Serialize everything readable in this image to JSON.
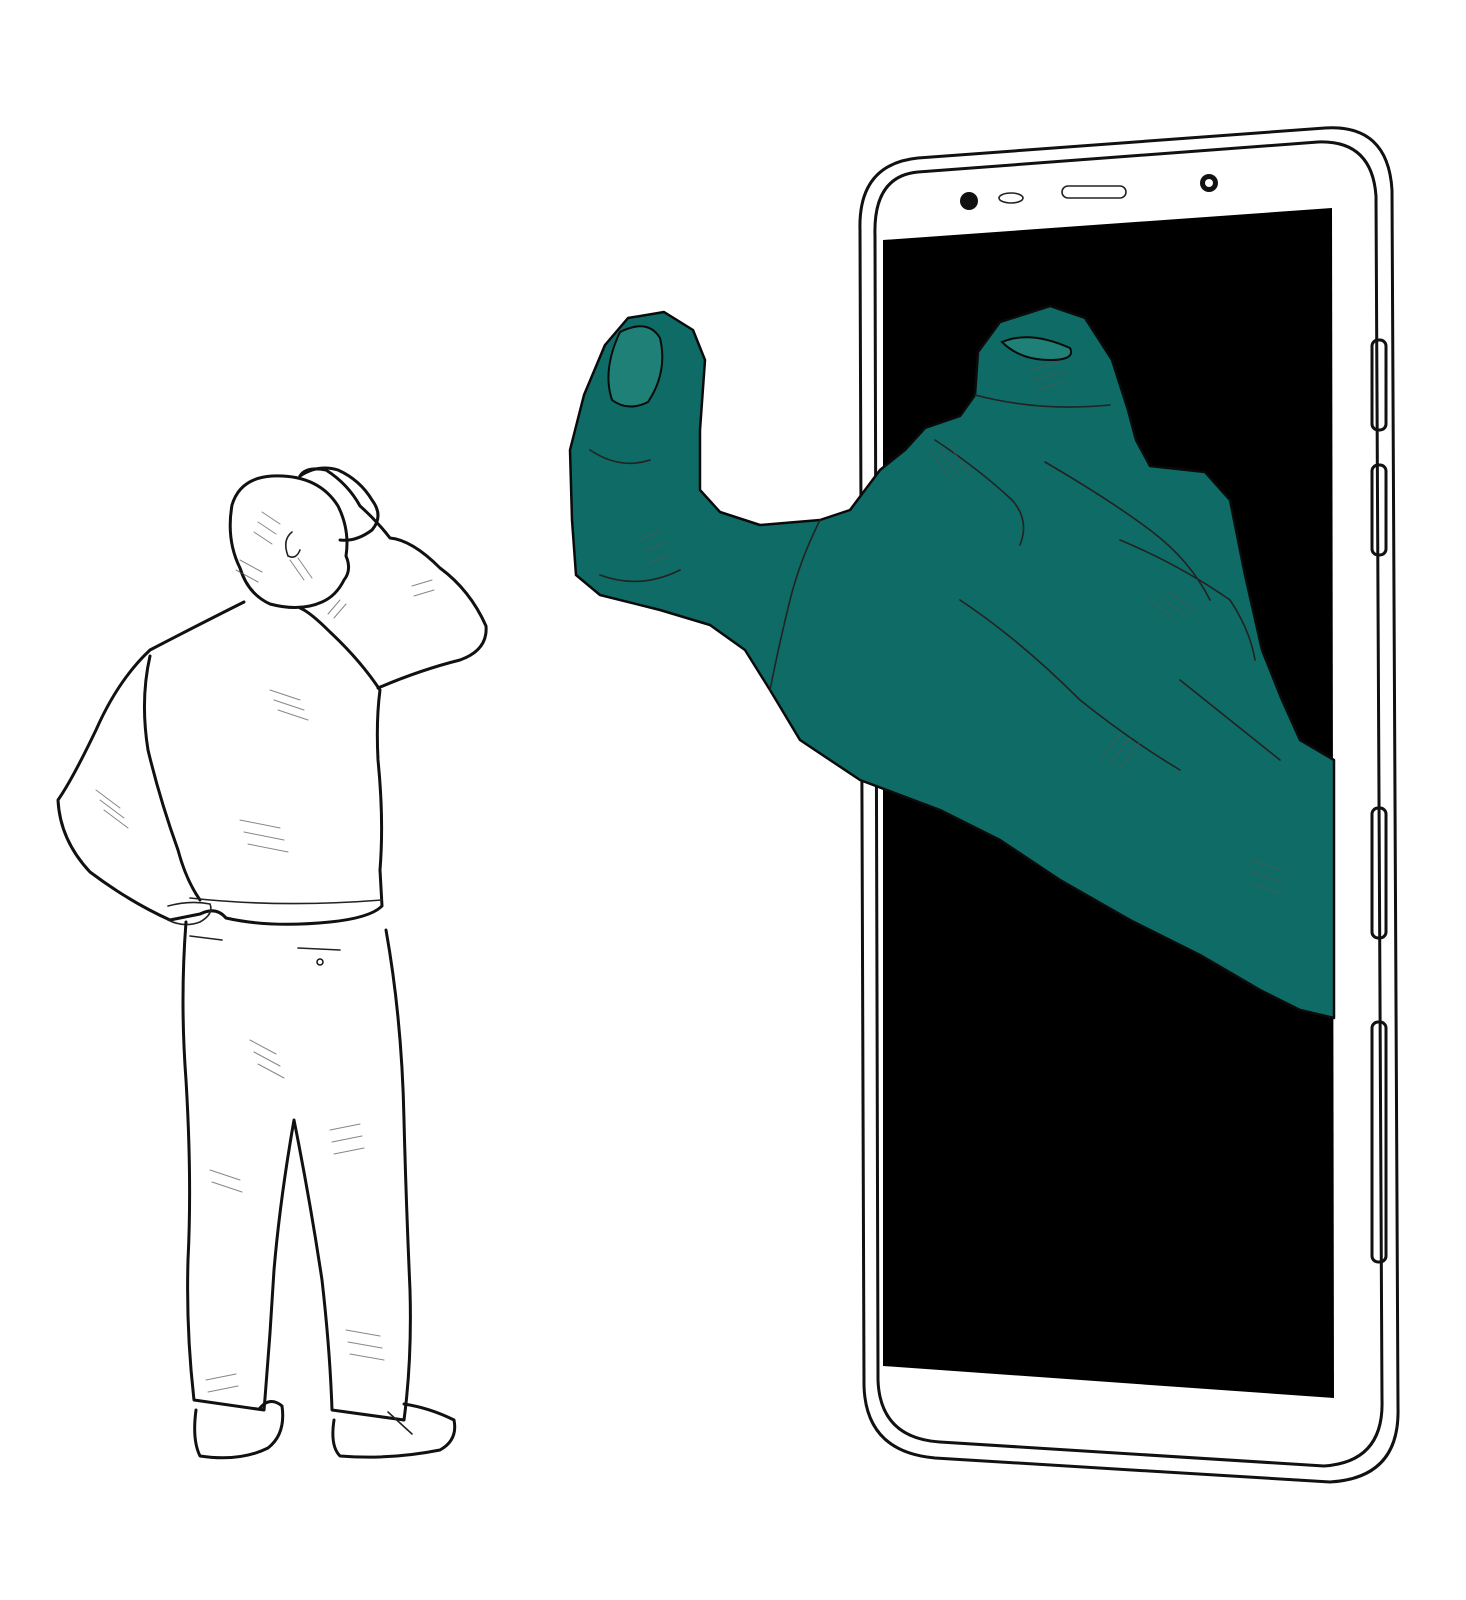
{
  "colors": {
    "background": "#ffffff",
    "line_ink": "#111111",
    "phone_screen": "#000000",
    "hand_teal": "#0e6b66",
    "hand_highlight": "#1f8078"
  },
  "scene": {
    "illustration": "phone-luring-person",
    "icons": [
      "phone-icon",
      "beckoning-hand-icon",
      "person-icon"
    ]
  }
}
